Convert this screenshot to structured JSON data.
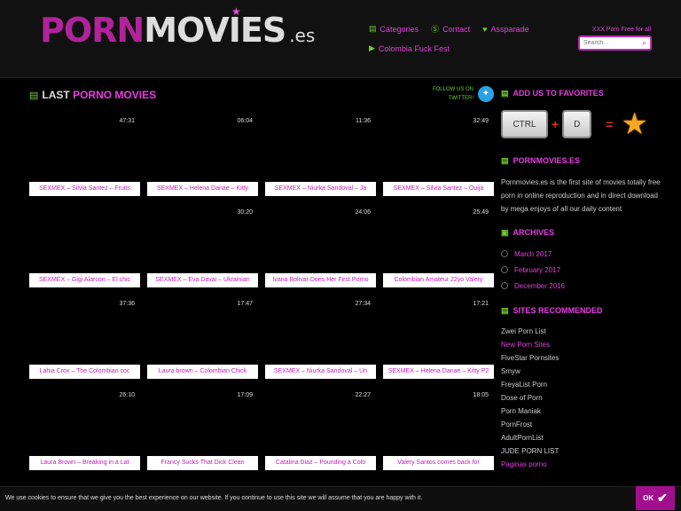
{
  "logo": {
    "part1": "PORN",
    "part2": "MOVIES",
    "suffix": ".es"
  },
  "topnav": [
    {
      "label": "Categories",
      "icon": "film-icon"
    },
    {
      "label": "Contact",
      "icon": "skype-icon"
    },
    {
      "label": "Assparade",
      "icon": "heart-icon"
    },
    {
      "label": "Colombia Fuck Fest",
      "icon": "play-icon"
    }
  ],
  "tagline": "XXX Porn Free for all",
  "search": {
    "placeholder": "Search..."
  },
  "main": {
    "title_prefix": "LAST",
    "title_highlight": "PORNO MOVIES",
    "follow_line1": "FOLLOW US ON",
    "follow_line2": "TWITTER!"
  },
  "videos": [
    {
      "duration": "47:31",
      "title": "SEXMEX – Silvia Santez – Fruits"
    },
    {
      "duration": "06:04",
      "title": "SEXMEX – Helena Danae – Kitty"
    },
    {
      "duration": "11:36",
      "title": "SEXMEX – Niurka Sandoval – Ja"
    },
    {
      "duration": "32:49",
      "title": "SEXMEX – Silvia Santez – Ouija"
    },
    {
      "duration": "",
      "title": "SEXMEX – Gigi Alarcon – El chic"
    },
    {
      "duration": "30:20",
      "title": "SEXMEX – Eva Davai – Ukrainian"
    },
    {
      "duration": "24:06",
      "title": "Ivana Bolivar Does Her First Porno"
    },
    {
      "duration": "25:49",
      "title": "Colombian Amateur 22yo Valery"
    },
    {
      "duration": "37:36",
      "title": "Lahia Crox – The Colombian coc"
    },
    {
      "duration": "17:47",
      "title": "Laura brown – Colombian Chick"
    },
    {
      "duration": "27:34",
      "title": "SEXMEX – Niurka Sandoval – Un"
    },
    {
      "duration": "17:21",
      "title": "SEXMEX – Helena Danae – Kitty P2"
    },
    {
      "duration": "26:10",
      "title": "Laura Brown – Breaking in a Lat"
    },
    {
      "duration": "17:09",
      "title": "Francy Sucks That Dick Clean"
    },
    {
      "duration": "22:27",
      "title": "Catalina Diaz – Pounding a Colo"
    },
    {
      "duration": "18:05",
      "title": "Valery Santos comes back for"
    }
  ],
  "sidebar": {
    "favorites_title": "ADD US TO FAVORITES",
    "key_ctrl": "CTRL",
    "key_plus": "+",
    "key_d": "D",
    "key_eq": "=",
    "about_title": "PORNMOVIES.ES",
    "about_text": "Pornmovies.es is the first site of movies totally free porn in online reproduction and in direct download by mega enjoys of all our daily content",
    "archives_title": "ARCHIVES",
    "archives": [
      "March 2017",
      "February 2017",
      "December 2016"
    ],
    "sites_title": "SITES RECOMMENDED",
    "sites": [
      "Zwei Porn List",
      "New Porn Sites",
      "FiveStar Pornsites",
      "Smyw",
      "FreyaList Porn",
      "Dose of Porn",
      "Porn Maniak",
      "PornFrost",
      "AdultPornList",
      "JUDE PORN LIST",
      "Paginas porno"
    ]
  },
  "cookie": {
    "text": "We use cookies to ensure that we give you the best experience on our website. If you continue to use this site we will assume that you are happy with it.",
    "ok_label": "OK"
  }
}
